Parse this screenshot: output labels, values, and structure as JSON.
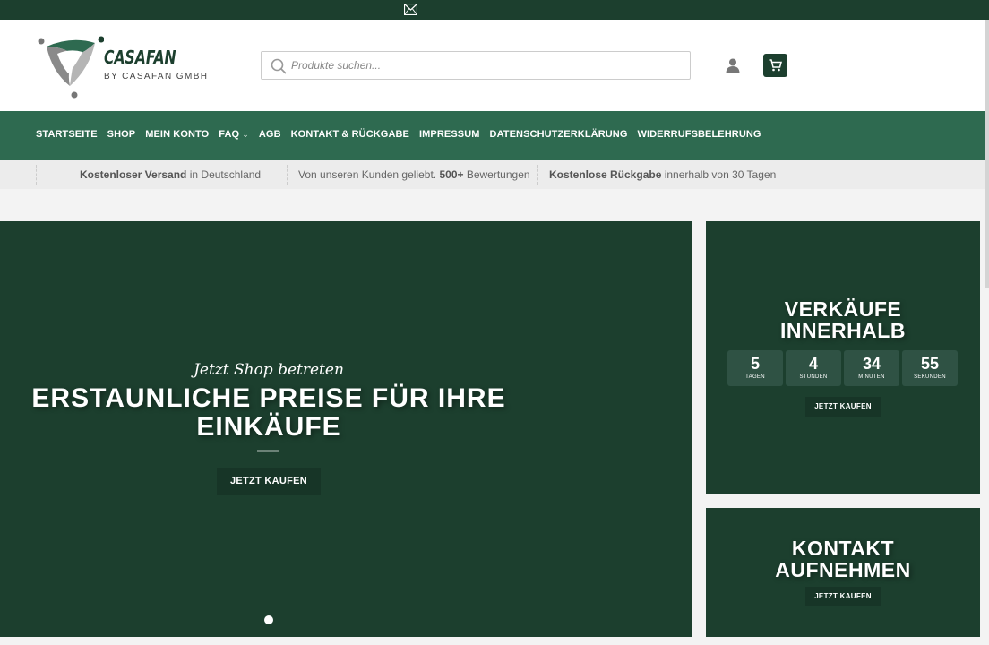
{
  "topbar": {
    "icon": "mail-icon"
  },
  "header": {
    "logo": {
      "brand": "CASAFAN",
      "sub": "BY CASAFAN GMBH"
    },
    "search": {
      "placeholder": "Produkte suchen..."
    },
    "account_icon": "user-icon",
    "cart_icon": "cart-icon"
  },
  "nav": {
    "items": [
      {
        "label": "STARTSEITE"
      },
      {
        "label": "SHOP"
      },
      {
        "label": "MEIN KONTO"
      },
      {
        "label": "FAQ"
      },
      {
        "label": "AGB"
      },
      {
        "label": "KONTAKT & RÜCKGABE"
      },
      {
        "label": "IMPRESSUM"
      },
      {
        "label": "DATENSCHUTZERKLÄRUNG"
      },
      {
        "label": "WIDERRUFSBELEHRUNG"
      }
    ]
  },
  "infobar": {
    "items": [
      {
        "bold": "Kostenloser Versand",
        "text": " in Deutschland"
      },
      {
        "text": "Von unseren Kunden geliebt. ",
        "bold": "500+",
        "text2": " Bewertungen"
      },
      {
        "bold": "Kostenlose Rückgabe",
        "text": " innerhalb von 30 Tagen"
      }
    ]
  },
  "hero": {
    "script": "Jetzt Shop betreten",
    "headline_line1": "ERSTAUNLICHE PREISE FÜR IHRE",
    "headline_line2": "EINKÄUFE",
    "button": "JETZT KAUFEN"
  },
  "card1": {
    "title_line1": "VERKÄUFE",
    "title_line2": "INNERHALB",
    "countdown": [
      {
        "value": "5",
        "label": "TAGEN"
      },
      {
        "value": "4",
        "label": "STUNDEN"
      },
      {
        "value": "34",
        "label": "MINUTEN"
      },
      {
        "value": "55",
        "label": "SEKUNDEN"
      }
    ],
    "button": "JETZT KAUFEN"
  },
  "card2": {
    "title_line1": "KONTAKT",
    "title_line2": "AUFNEHMEN",
    "button": "JETZT KAUFEN"
  },
  "colors": {
    "dark_green": "#1c3f2e",
    "nav_green": "#2e6a50"
  }
}
